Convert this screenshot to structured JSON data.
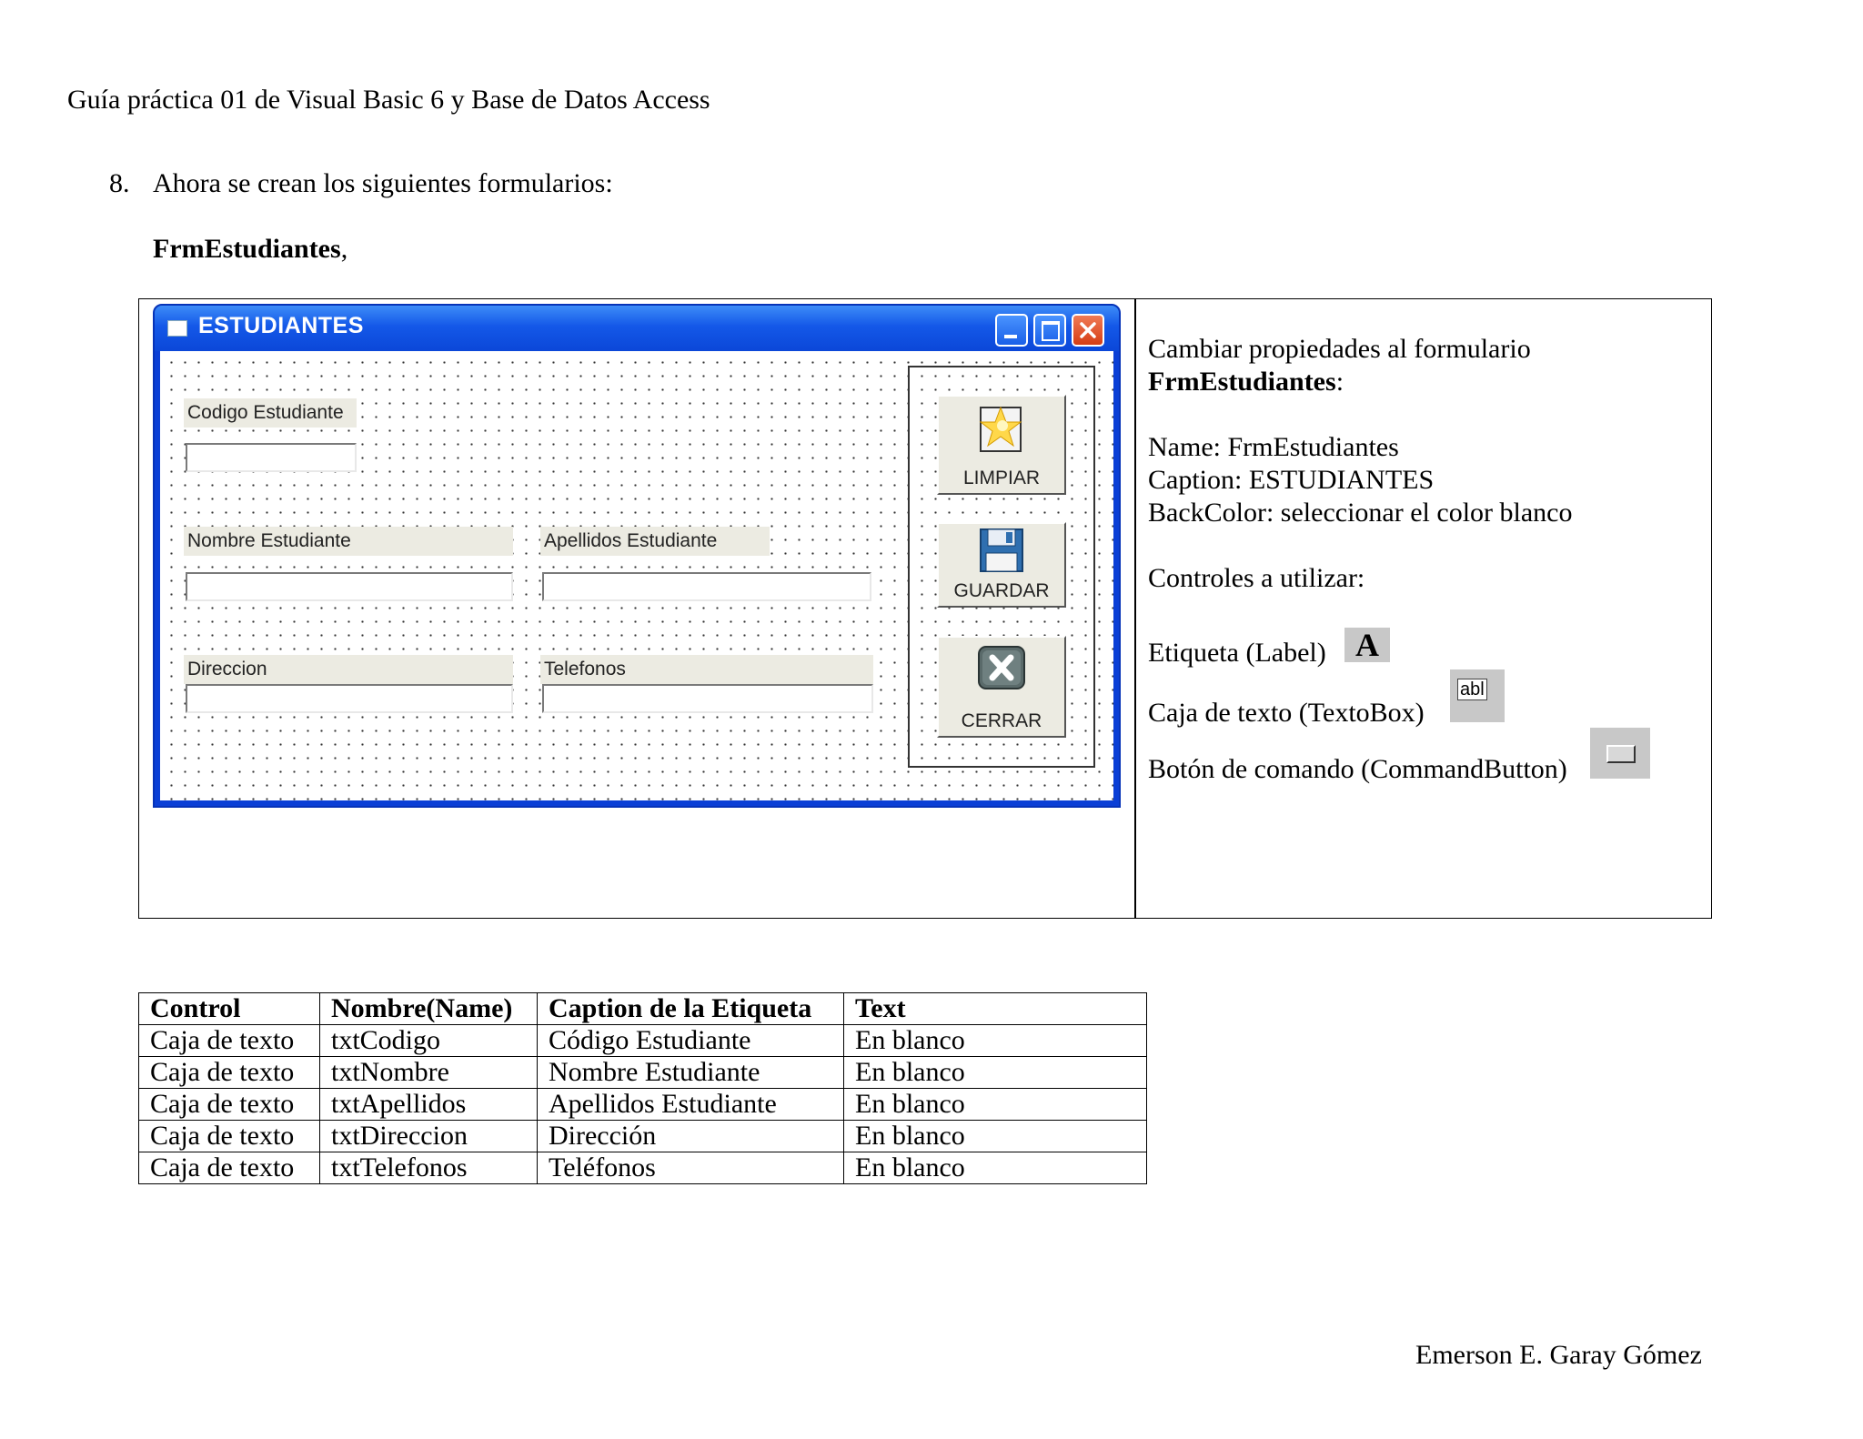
{
  "header": {
    "text": "Guía práctica 01 de Visual Basic 6 y Base de Datos Access"
  },
  "step": {
    "number": "8.",
    "text": "Ahora se crean los siguientes formularios:"
  },
  "form_heading": {
    "name": "FrmEstudiantes",
    "suffix": ","
  },
  "vb_form": {
    "title": "ESTUDIANTES",
    "labels": {
      "codigo": "Codigo Estudiante",
      "nombre": "Nombre Estudiante",
      "apellidos": "Apellidos Estudiante",
      "direccion": "Direccion",
      "telefonos": "Telefonos"
    },
    "buttons": {
      "limpiar": "LIMPIAR",
      "guardar": "GUARDAR",
      "cerrar": "CERRAR"
    }
  },
  "instructions": {
    "intro": "Cambiar propiedades al formulario",
    "form_name": "FrmEstudiantes",
    "form_name_suffix": ":",
    "name_line": "Name: FrmEstudiantes",
    "caption_line": "Caption: ESTUDIANTES",
    "backcolor_line": "BackColor: seleccionar el color blanco",
    "controls_heading": "Controles a utilizar:",
    "control_label": "Etiqueta (Label)",
    "control_textbox": "Caja de texto (TextoBox)",
    "control_button": "Botón de comando (CommandButton)",
    "label_icon_glyph": "A",
    "textbox_icon_glyph": "abl"
  },
  "table": {
    "headers": [
      "Control",
      "Nombre(Name)",
      "Caption de la Etiqueta",
      "Text"
    ],
    "rows": [
      [
        "Caja de texto",
        "txtCodigo",
        "Código Estudiante",
        "En blanco"
      ],
      [
        "Caja de texto",
        "txtNombre",
        "Nombre Estudiante",
        "En blanco"
      ],
      [
        "Caja de texto",
        "txtApellidos",
        "Apellidos Estudiante",
        "En blanco"
      ],
      [
        "Caja de texto",
        "txtDireccion",
        "Dirección",
        "En blanco"
      ],
      [
        "Caja de texto",
        "txtTelefonos",
        "Teléfonos",
        "En blanco"
      ]
    ]
  },
  "footer": {
    "author": "Emerson E. Garay Gómez"
  }
}
